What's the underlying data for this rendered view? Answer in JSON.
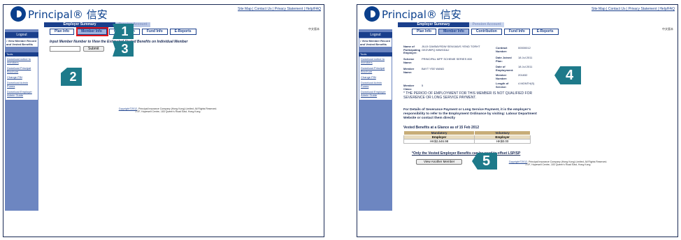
{
  "brand": {
    "name": "Principal",
    "chinese": "信安"
  },
  "top_links": "Site Map | Contact Us | Privacy Statement | Help/FAQ",
  "lang_link": "中文版本",
  "tabs": {
    "employer_summary": "Employer Summary",
    "pension": "Pension Account"
  },
  "subtabs": [
    "Plan Info",
    "Member Info",
    "Contribution",
    "Fund Info",
    "E-Reports"
  ],
  "sidebar": {
    "logout": "Logout",
    "view_member": "• View Member Record and Vested Benefits",
    "tools_label": "Tools",
    "links": [
      "Download notice to members",
      "Download Principal Brochure",
      "Change PIN",
      "Download Admin Forms",
      "Download Employer Admin Guide"
    ]
  },
  "left": {
    "prompt": "Input Member Number to View the Estimated Vested Benefits on Individual Member",
    "input_value": "",
    "submit": "Submit"
  },
  "copyright": {
    "link": "Copyright ©2012",
    "text": "Principal Insurance Company (Hong Kong) Limited. All Rights Reserved.",
    "address": "27/F, Hopewell Centre, 183 Queen's Road East, Hong Kong"
  },
  "right": {
    "name_label": "Name of Participating Employer:",
    "name_value": "JIUJI GAVBAYRDW SEWJIAVS YEND TORHT GEZVBPQ MIWGDAJ",
    "contract_label": "Contract Number:",
    "contract_value": "00000012",
    "scheme_label": "Scheme Name:",
    "scheme_value": "PRINCIPAL MPF SCHEME SERIES 800",
    "date_joined_label": "Date Joined Plan:",
    "date_joined_value": "18 Jul 2011",
    "member_name_label": "Member Name:",
    "member_name_value": "BAYT YSE WAND",
    "doe_label": "Date of Employment:",
    "doe_value": "18 Jul 2011",
    "member_no_label": "Member Number:",
    "member_no_value": "201832",
    "class_label": "Member Class:",
    "class_value": "5",
    "los_label": "Length of Service:",
    "los_value": "4 MONTH(S)",
    "notice": "* THE PERIOD OF EMPLOYMENT FOR THIS MEMBER IS NOT QUALIFIED FOR SEVERENCE OR LONG SERVICE PAYMENT.",
    "severance": "For Details of Severance Payment or Long Service Payment, it is the employer's responsibility to refer to the Employment Ordinance by visiting: Labour Department Website or contact them directly",
    "glance": "Vested Benefits at a Glance as of 15 Feb 2012",
    "table": {
      "headers": [
        "Mandatory",
        "Voluntary"
      ],
      "sub": [
        "Employer",
        "Employer"
      ],
      "values": [
        "HK$2,646.98",
        "HK$0.00"
      ]
    },
    "offset_note": "*Only the Vested Employer Benefits can be used to offset LSP/SP",
    "view_another": "View Another Member"
  },
  "badges": [
    "1",
    "2",
    "3",
    "4",
    "5"
  ],
  "colors": {
    "navy": "#1a3f8c",
    "teal_badge": "#1e7a8a",
    "highlight": "#e0151b",
    "sidebar": "#6d86c1"
  }
}
